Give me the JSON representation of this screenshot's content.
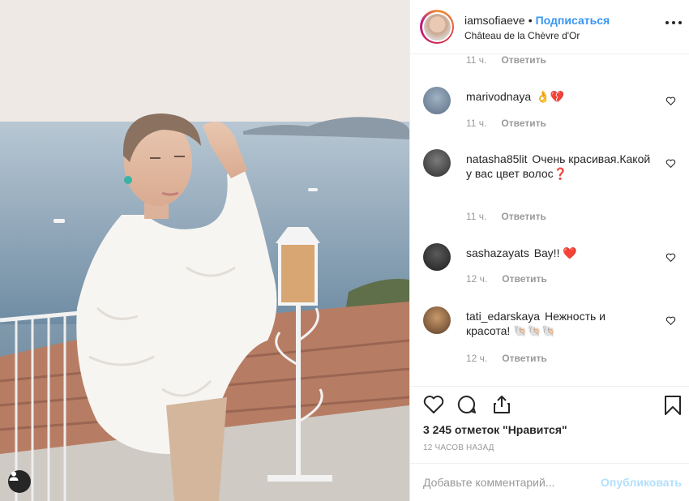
{
  "post": {
    "username": "iamsofiaeve",
    "follow_label": "Подписаться",
    "separator": "•",
    "location": "Château de la Chèvre d'Or"
  },
  "comments": [
    {
      "time": "11 ч.",
      "reply": "Ответить"
    },
    {
      "username": "marivodnaya",
      "text": "👌💔",
      "time": "11 ч.",
      "reply": "Ответить"
    },
    {
      "username": "natasha85lit",
      "text": "Очень красивая.Какой у вас цвет волос❓",
      "time": "11 ч.",
      "reply": "Ответить"
    },
    {
      "username": "sashazayats",
      "text": "Вау!! ❤️",
      "time": "12 ч.",
      "reply": "Ответить"
    },
    {
      "username": "tati_edarskaya",
      "text": "Нежность и красота! 🐚🐚🐚",
      "time": "12 ч.",
      "reply": "Ответить"
    }
  ],
  "actions": {
    "likes_text": "3 245 отметок \"Нравится\"",
    "timestamp": "12 ЧАСОВ НАЗАД"
  },
  "add_comment": {
    "placeholder": "Добавьте комментарий...",
    "publish_label": "Опубликовать"
  },
  "icons": {
    "more": "more-horizontal-icon",
    "like": "heart-icon",
    "comment": "comment-bubble-icon",
    "share": "share-icon",
    "save": "bookmark-icon",
    "user_tag": "user-tag-icon"
  },
  "colors": {
    "link_blue": "#3897f0",
    "muted": "#999999",
    "text": "#262626",
    "publish_disabled": "#b2dffc",
    "heart_red": "#ed4956"
  }
}
